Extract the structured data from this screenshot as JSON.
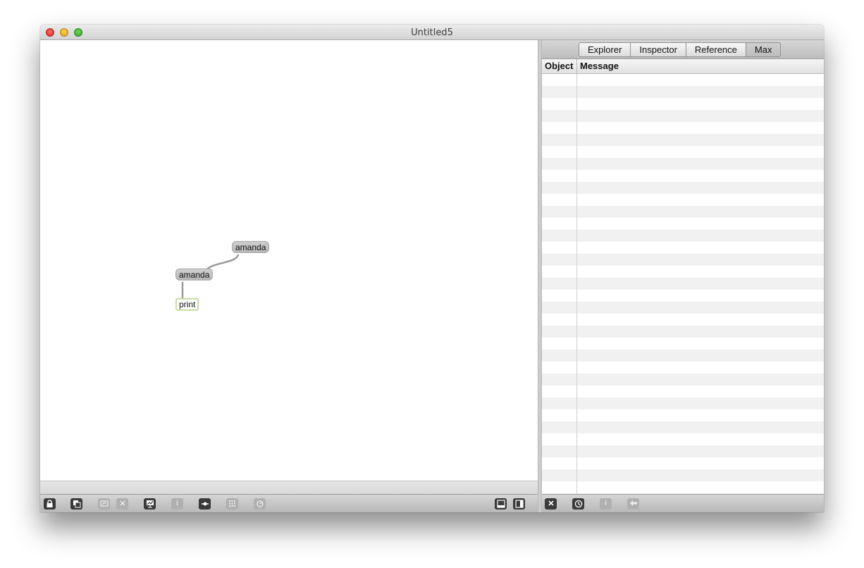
{
  "window": {
    "title": "Untitled5"
  },
  "patcher": {
    "objects": [
      {
        "kind": "message",
        "text": "amanda"
      },
      {
        "kind": "message",
        "text": "amanda"
      },
      {
        "kind": "object",
        "text": "print"
      }
    ]
  },
  "sidebar": {
    "tabs": [
      {
        "label": "Explorer"
      },
      {
        "label": "Inspector"
      },
      {
        "label": "Reference"
      },
      {
        "label": "Max",
        "active": true
      }
    ],
    "console": {
      "columns": {
        "object": "Object",
        "message": "Message"
      },
      "rows": []
    }
  },
  "toolbar_left": {
    "buttons": [
      {
        "icon": "lock-icon",
        "enabled": true
      },
      {
        "icon": "new-view-icon",
        "enabled": true
      },
      {
        "icon": "presentation-icon",
        "enabled": false
      },
      {
        "icon": "delete-icon",
        "enabled": false
      },
      {
        "icon": "debug-icon",
        "enabled": true
      },
      {
        "icon": "info-icon",
        "enabled": false
      },
      {
        "icon": "bpatcher-icon",
        "enabled": true
      },
      {
        "icon": "grid-icon",
        "enabled": false
      },
      {
        "icon": "snap-icon",
        "enabled": false
      },
      {
        "icon": "layout-bottom-icon",
        "enabled": true
      },
      {
        "icon": "layout-right-icon",
        "enabled": true
      }
    ]
  },
  "toolbar_right": {
    "buttons": [
      {
        "icon": "clear-icon",
        "enabled": true
      },
      {
        "icon": "clock-icon",
        "enabled": true
      },
      {
        "icon": "info-icon",
        "enabled": false
      },
      {
        "icon": "back-icon",
        "enabled": false
      }
    ]
  }
}
